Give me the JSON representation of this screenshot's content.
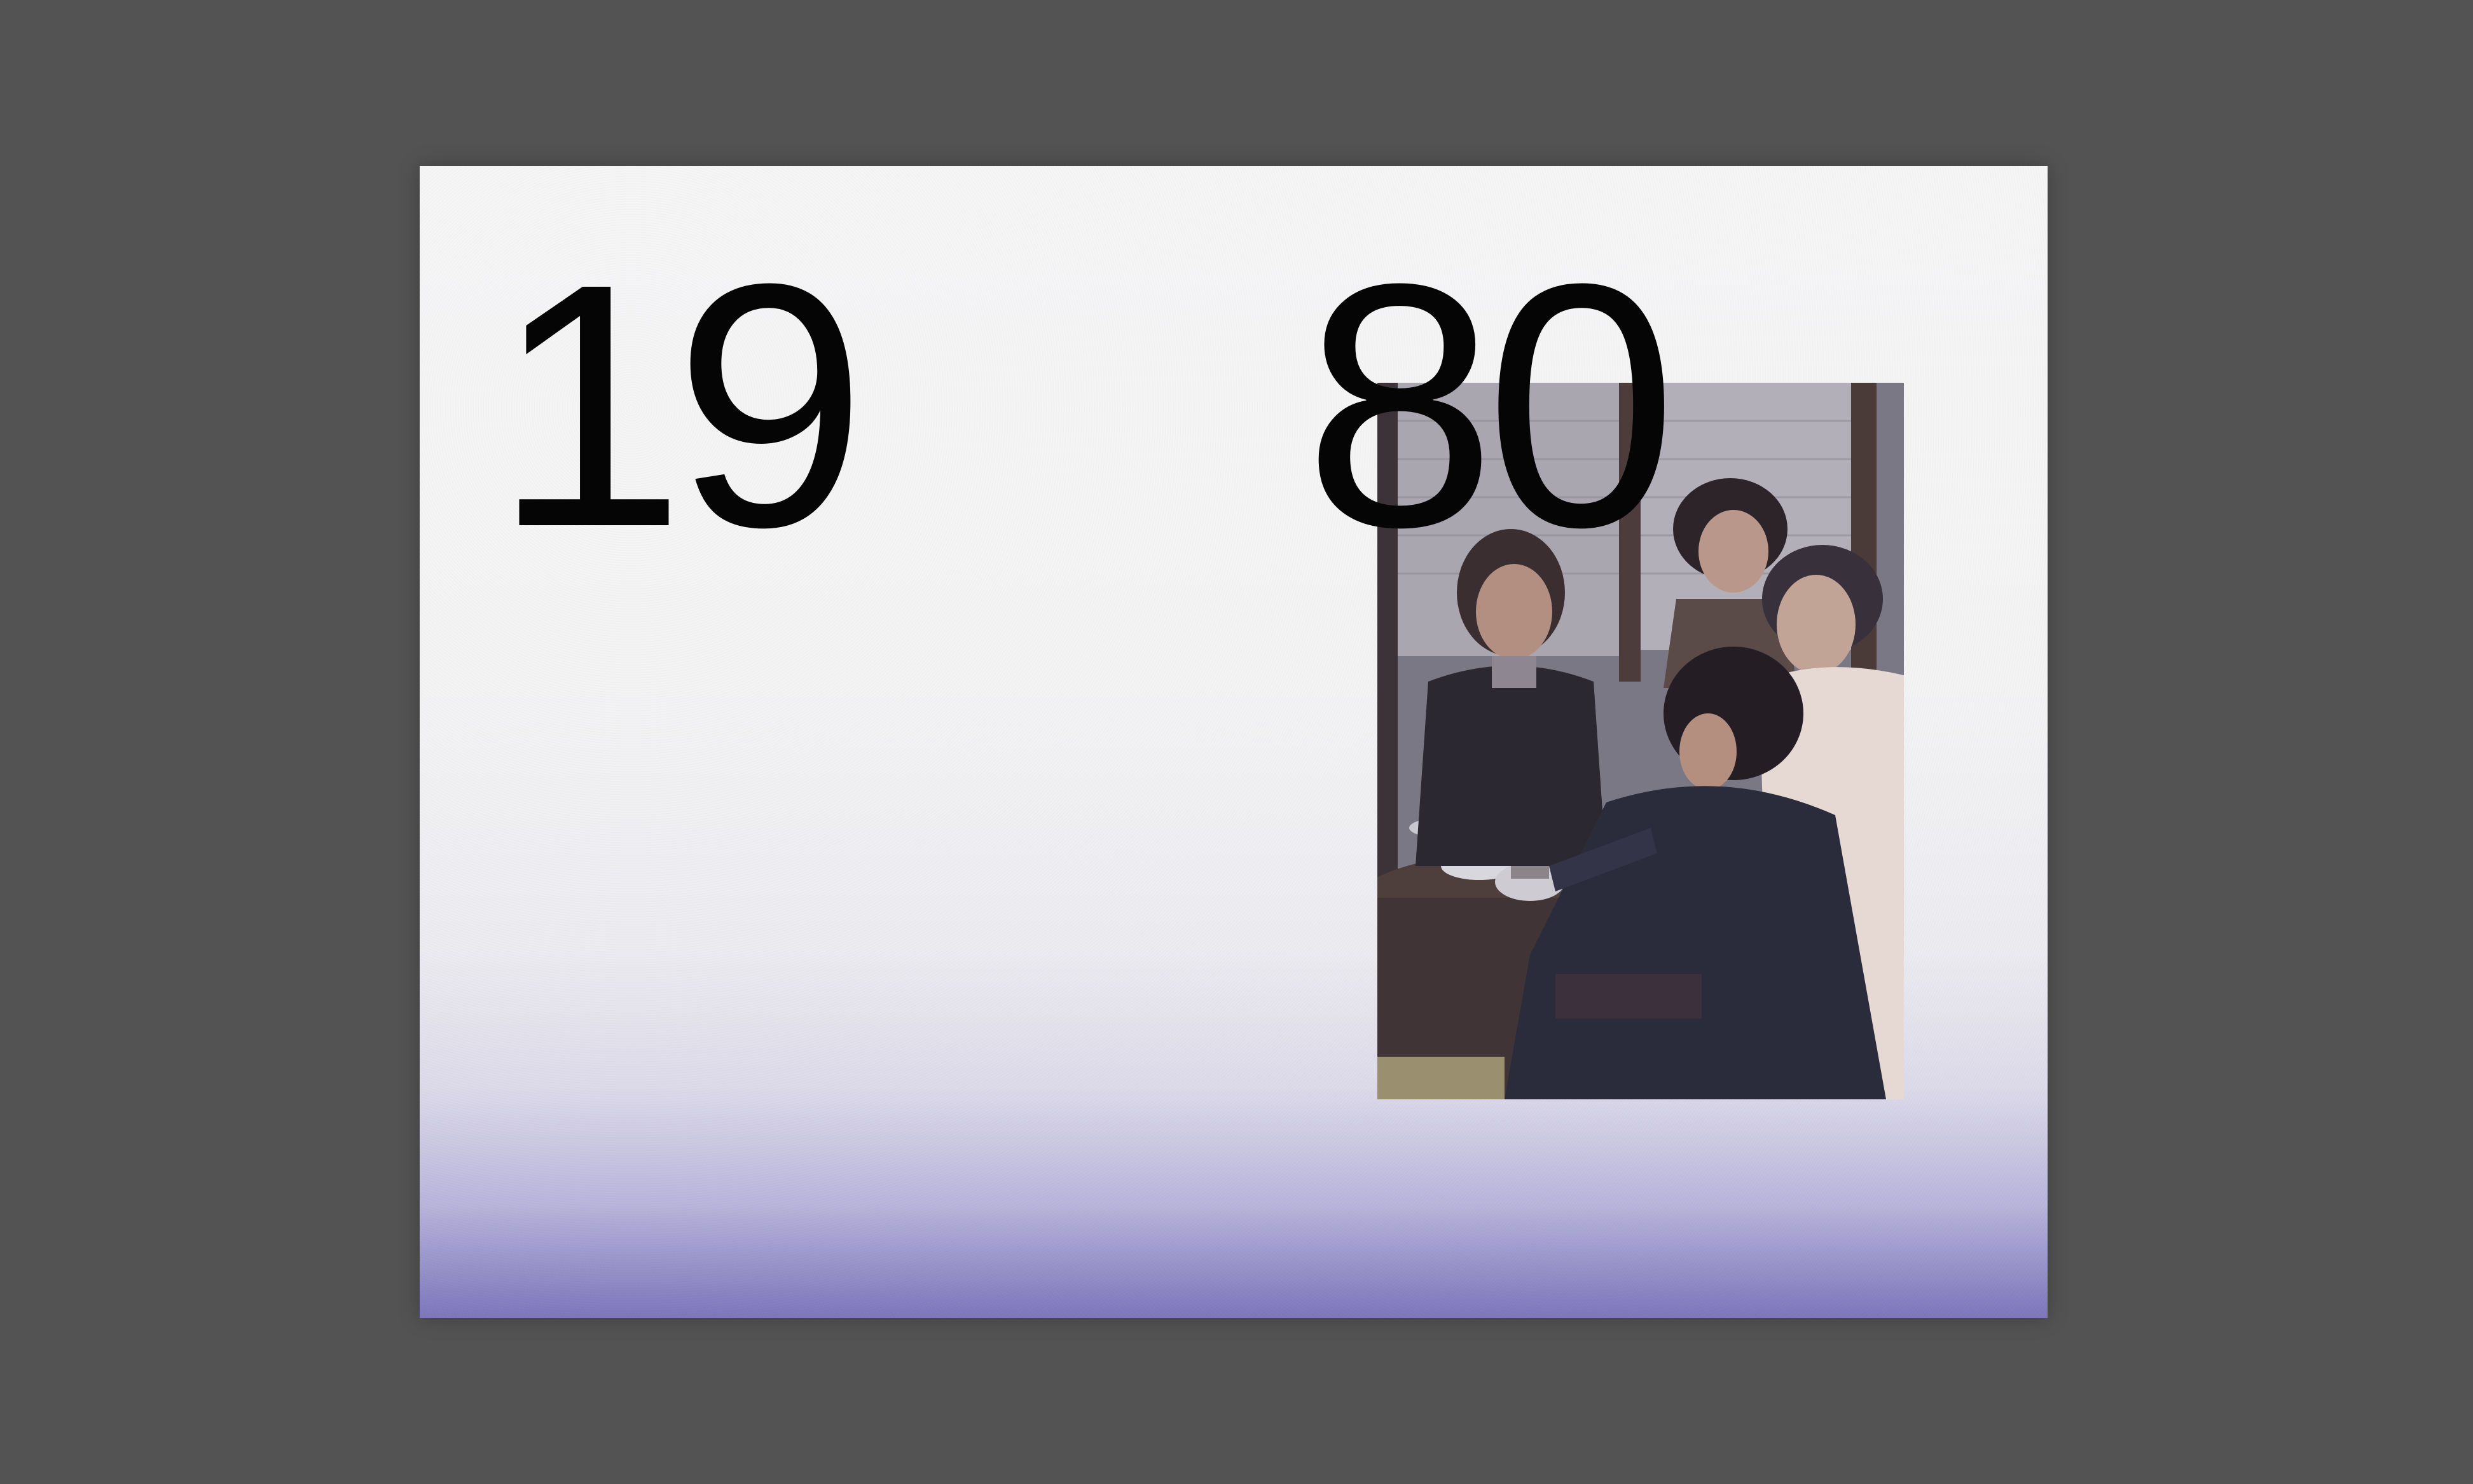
{
  "poster": {
    "numeral_left": "19",
    "numeral_right": "80"
  },
  "colors": {
    "backdrop": "#535353",
    "paper": "#f5f5f6",
    "gradient_bottom": "#7d76bb",
    "numerals": "#050505"
  }
}
